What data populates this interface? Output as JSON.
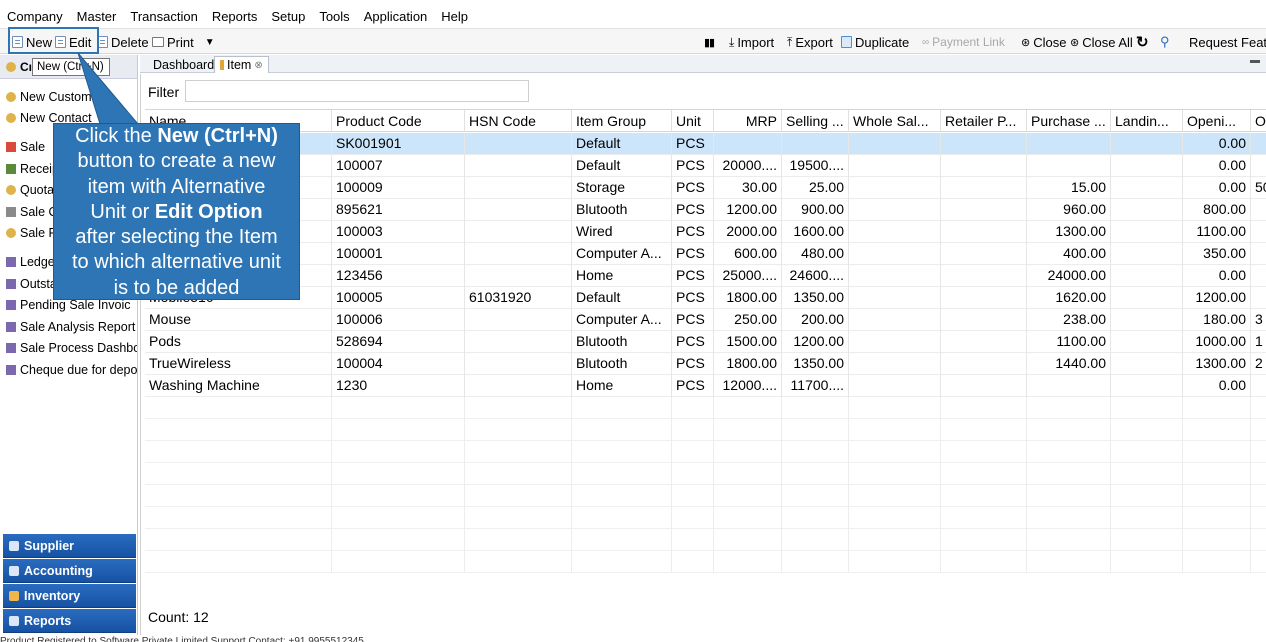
{
  "menu": [
    "Company",
    "Master",
    "Transaction",
    "Reports",
    "Setup",
    "Tools",
    "Application",
    "Help"
  ],
  "toolbar": {
    "new": "New",
    "edit": "Edit",
    "delete": "Delete",
    "print": "Print",
    "import": "Import",
    "export": "Export",
    "duplicate": "Duplicate",
    "payment_link": "Payment Link",
    "close": "Close",
    "close_all": "Close All",
    "request_feature": "Request Featu"
  },
  "tooltip": "New (Ctrl+N)",
  "left_panel": {
    "header": "Cı",
    "items": [
      "New Custom",
      "New Contact",
      "Sale",
      "Receip",
      "Quota",
      "Sale O",
      "Sale R",
      "Ledge",
      "Outsta",
      "Pending Sale Invoic",
      "Sale Analysis Report",
      "Sale Process Dashboa",
      "Cheque due for depos"
    ],
    "sections": [
      "Supplier",
      "Accounting",
      "Inventory",
      "Reports"
    ]
  },
  "tabs": [
    "Dashboard",
    "Item"
  ],
  "filter": {
    "label": "Filter",
    "value": ""
  },
  "grid": {
    "columns": [
      "Name",
      "Product Code",
      "HSN Code",
      "Item Group",
      "Unit",
      "MRP",
      "Selling ...",
      "Whole Sal...",
      "Retailer P...",
      "Purchase ...",
      "Landin...",
      "Openi...",
      "Op"
    ],
    "rows": [
      [
        "",
        "SK001901",
        "",
        "Default",
        "PCS",
        "",
        "",
        "",
        "",
        "",
        "",
        "0.00",
        ""
      ],
      [
        "",
        "100007",
        "",
        "Default",
        "PCS",
        "20000....",
        "19500....",
        "",
        "",
        "",
        "",
        "0.00",
        ""
      ],
      [
        "",
        "100009",
        "",
        "Storage",
        "PCS",
        "30.00",
        "25.00",
        "",
        "",
        "15.00",
        "",
        "0.00",
        "50"
      ],
      [
        "",
        "895621",
        "",
        "Blutooth",
        "PCS",
        "1200.00",
        "900.00",
        "",
        "",
        "960.00",
        "",
        "800.00",
        ""
      ],
      [
        "",
        "100003",
        "",
        "Wired",
        "PCS",
        "2000.00",
        "1600.00",
        "",
        "",
        "1300.00",
        "",
        "1100.00",
        ""
      ],
      [
        "",
        "100001",
        "",
        "Computer A...",
        "PCS",
        "600.00",
        "480.00",
        "",
        "",
        "400.00",
        "",
        "350.00",
        ""
      ],
      [
        "",
        "123456",
        "",
        "Home",
        "PCS",
        "25000....",
        "24600....",
        "",
        "",
        "24000.00",
        "",
        "0.00",
        ""
      ],
      [
        "Mobile510",
        "100005",
        "61031920",
        "Default",
        "PCS",
        "1800.00",
        "1350.00",
        "",
        "",
        "1620.00",
        "",
        "1200.00",
        ""
      ],
      [
        "Mouse",
        "100006",
        "",
        "Computer A...",
        "PCS",
        "250.00",
        "200.00",
        "",
        "",
        "238.00",
        "",
        "180.00",
        "3"
      ],
      [
        "Pods",
        "528694",
        "",
        "Blutooth",
        "PCS",
        "1500.00",
        "1200.00",
        "",
        "",
        "1100.00",
        "",
        "1000.00",
        "1"
      ],
      [
        "TrueWireless",
        "100004",
        "",
        "Blutooth",
        "PCS",
        "1800.00",
        "1350.00",
        "",
        "",
        "1440.00",
        "",
        "1300.00",
        "2"
      ],
      [
        "Washing Machine",
        "1230",
        "",
        "Home",
        "PCS",
        "12000....",
        "11700....",
        "",
        "",
        "",
        "",
        "0.00",
        ""
      ]
    ]
  },
  "count_label": "Count: 12",
  "callout": {
    "line1_pre": "Click the ",
    "line1_bold": "New (Ctrl+N)",
    "line2": "button to create a new",
    "line3": "item with Alternative",
    "line4_pre": "Unit or ",
    "line4_bold": "Edit Option",
    "line5": "after selecting the Item",
    "line6": "to which alternative unit",
    "line7": "is to be added"
  },
  "status_text": "Product Registered to Software Private Limited  Support Contact: +91 9955512345",
  "colors": {
    "callout_bg": "#2e75b6",
    "section_bg": "#1f5fb0",
    "selected_row": "#cce5fb"
  }
}
